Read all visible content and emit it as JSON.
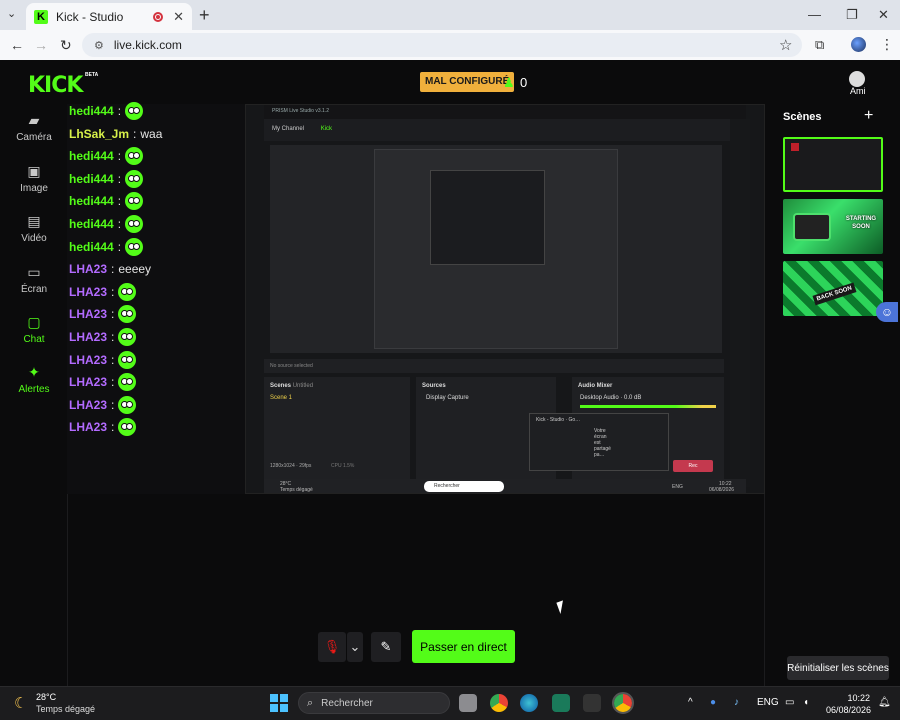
{
  "browser": {
    "tab_title": "Kick - Studio",
    "tab_favicon": "K",
    "url": "live.kick.com",
    "new_tab": "+",
    "controls": {
      "minimize": "—",
      "maximize": "❐",
      "close": "✕",
      "back": "←",
      "forward": "→",
      "reload": "↻",
      "tabs_menu": "⌄",
      "tune": "⚙",
      "star": "☆",
      "extensions": "⧉",
      "more": "⋮",
      "tab_close": "✕"
    }
  },
  "header": {
    "logo": "KICK",
    "logo_badge": "BETA",
    "status_badge": "MAL CONFIGURÉ",
    "viewer_icon": "♟",
    "viewer_count": "0",
    "account_name": "Ami"
  },
  "rail": [
    {
      "label": "Caméra",
      "icon": "▰",
      "active": false
    },
    {
      "label": "Image",
      "icon": "▣",
      "active": false
    },
    {
      "label": "Vidéo",
      "icon": "▤",
      "active": false
    },
    {
      "label": "Écran",
      "icon": "▭",
      "active": false
    },
    {
      "label": "Chat",
      "icon": "▢",
      "active": true
    },
    {
      "label": "Alertes",
      "icon": "✦",
      "active": true
    }
  ],
  "chat": [
    {
      "user": "hedi444",
      "color": "#53fc18",
      "text": "",
      "emote": true
    },
    {
      "user": "LhSak_Jm",
      "color": "#d7f04a",
      "text": "waa",
      "emote": false
    },
    {
      "user": "hedi444",
      "color": "#53fc18",
      "text": "",
      "emote": true
    },
    {
      "user": "hedi444",
      "color": "#53fc18",
      "text": "",
      "emote": true
    },
    {
      "user": "hedi444",
      "color": "#53fc18",
      "text": "",
      "emote": true
    },
    {
      "user": "hedi444",
      "color": "#53fc18",
      "text": "",
      "emote": true
    },
    {
      "user": "hedi444",
      "color": "#53fc18",
      "text": "",
      "emote": true
    },
    {
      "user": "LHA23",
      "color": "#b36bff",
      "text": "eeeey",
      "emote": false
    },
    {
      "user": "LHA23",
      "color": "#b36bff",
      "text": "",
      "emote": true
    },
    {
      "user": "LHA23",
      "color": "#b36bff",
      "text": "",
      "emote": true
    },
    {
      "user": "LHA23",
      "color": "#b36bff",
      "text": "",
      "emote": true
    },
    {
      "user": "LHA23",
      "color": "#b36bff",
      "text": "",
      "emote": true
    },
    {
      "user": "LHA23",
      "color": "#b36bff",
      "text": "",
      "emote": true
    },
    {
      "user": "LHA23",
      "color": "#b36bff",
      "text": "",
      "emote": true
    },
    {
      "user": "LHA23",
      "color": "#b36bff",
      "text": "",
      "emote": true
    }
  ],
  "preview": {
    "app_title": "PRISM Live Studio v3.1.2",
    "channel": "My Channel",
    "channel_name": "Kick",
    "no_source": "No source selected",
    "scenes_label": "Scenes",
    "scenes_untitled": "Untitled",
    "scene1": "Scene 1",
    "sources_label": "Sources",
    "source1": "Display Capture",
    "mixer_label": "Audio Mixer",
    "mixer_item": "Desktop Audio · 0.0 dB",
    "resolution": "1280x1024 · 29fps",
    "cpu": "CPU 1.5%",
    "share_title": "Kick - Studio · Go…",
    "share_msg": "Votre écran est partagé pa…",
    "rec": "Rec",
    "weather_temp": "28°C",
    "weather_desc": "Temps dégagé",
    "search": "Rechercher",
    "lang": "ENG",
    "time": "10:22",
    "date": "06/08/2026"
  },
  "controls": {
    "mic_icon": "mic-off",
    "dropdown": "⌄",
    "edit": "✎",
    "go_live": "Passer en direct"
  },
  "scenes": {
    "title": "Scènes",
    "add": "+",
    "items": [
      {
        "label": ""
      },
      {
        "label": "STARTING SOON"
      },
      {
        "label": "BACK SOON"
      }
    ],
    "reset": "Réinitialiser les scènes"
  },
  "taskbar": {
    "weather_temp": "28°C",
    "weather_desc": "Temps dégagé",
    "search": "Rechercher",
    "lang": "ENG",
    "time": "10:22",
    "date": "06/08/2026"
  },
  "colors": {
    "accent": "#53fc18",
    "warning": "#f0b03c",
    "danger": "#e91916"
  }
}
